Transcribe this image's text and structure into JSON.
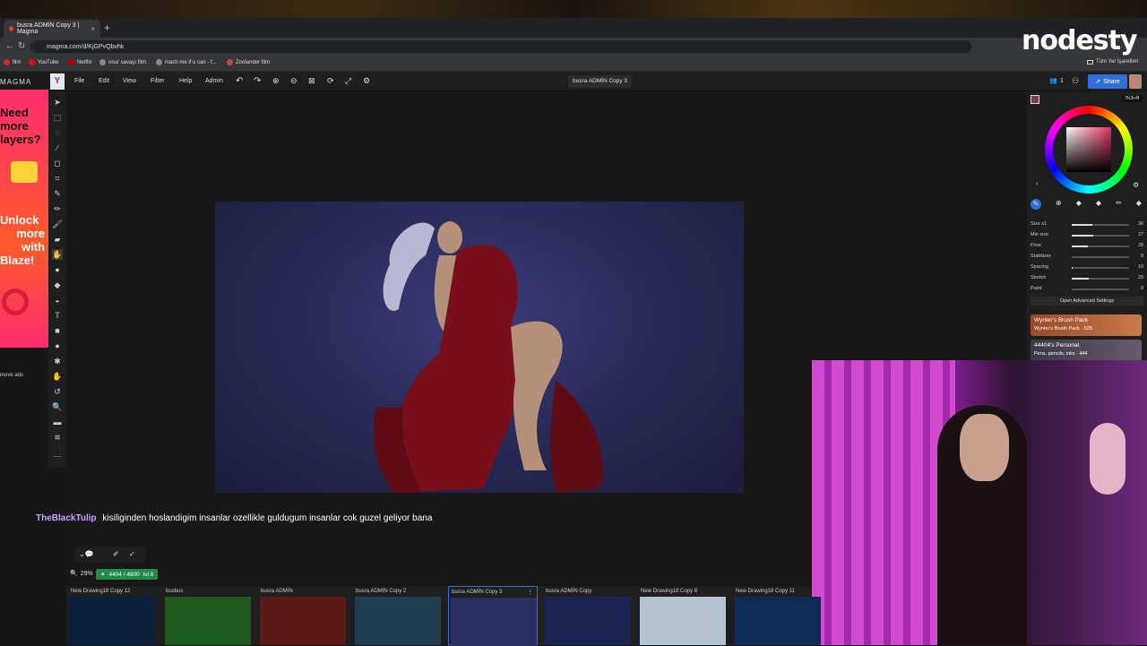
{
  "browser": {
    "tab_title": "busra ADMİN Copy 3 | Magma",
    "tab_close": "×",
    "new_tab": "+",
    "url": "magma.com/d/KjGPvQbvhk",
    "bookmarks": [
      "film",
      "YouTube",
      "Netflix",
      "onur savaşı film",
      "mach me if u can - f...",
      "Zoolander film"
    ],
    "bookmarks_right": "Tüm Yer İşaretleri"
  },
  "stream_logo": "nodesty",
  "ad": {
    "brand": "MAGMA",
    "lines": [
      "Need",
      "more",
      "layers?",
      "Unlock",
      "more",
      "with",
      "Blaze!"
    ],
    "remove_ads": "move ads"
  },
  "menu": {
    "items": [
      "File",
      "Edit",
      "View",
      "Filter",
      "Help",
      "Admin"
    ],
    "doc_title": "busra ADMİN Copy 3",
    "users_count": "1",
    "share_label": "Share",
    "color_hex": "7b3c4f"
  },
  "brush_settings": [
    {
      "label": "Size x1",
      "value": "36",
      "fraction": 0.36
    },
    {
      "label": "Min size",
      "value": "37",
      "fraction": 0.37
    },
    {
      "label": "Flow",
      "value": "28",
      "fraction": 0.28
    },
    {
      "label": "Stabilizer",
      "value": "0",
      "fraction": 0.0
    },
    {
      "label": "Spacing",
      "value": "10",
      "fraction": 0.02
    },
    {
      "label": "Stretch",
      "value": "29",
      "fraction": 0.29
    },
    {
      "label": "Paint",
      "value": "0",
      "fraction": 0.0
    }
  ],
  "advanced_settings": "Open Advanced Settings",
  "brush_packs": [
    {
      "title": "Wynter's Brush Pack",
      "sub": "Wynter's Brush Pack · 525"
    },
    {
      "title": "44404's Personal",
      "sub": "Pens, pencils, inks · 444"
    }
  ],
  "chat": {
    "user": "TheBlackTulip",
    "message": "kisiliginden hoslandigim insanlar ozellikle guldugum insanlar cok guzel geliyor bana"
  },
  "status": {
    "zoom": "29%",
    "storage": "4404 / 4800",
    "level": "lvl 6"
  },
  "thumbnails": [
    {
      "name": "New Drawing18 Copy 12",
      "color": "#0c1e3a"
    },
    {
      "name": "busbus",
      "color": "#1f5a1f"
    },
    {
      "name": "busra ADMİN",
      "color": "#5a1818"
    },
    {
      "name": "busra ADMİN Copy 2",
      "color": "#1f3f4f"
    },
    {
      "name": "busra ADMİN Copy 3",
      "color": "#2b2e60"
    },
    {
      "name": "busra ADMİN Copy",
      "color": "#1c2350"
    },
    {
      "name": "New Drawing18 Copy 8",
      "color": "#b5c3cf"
    },
    {
      "name": "New Drawing18 Copy 11",
      "color": "#0f2a55"
    }
  ],
  "colors": {
    "accent": "#2f6fda",
    "primary_color": "#7b3c4f",
    "status_green": "#1f8a4c"
  }
}
